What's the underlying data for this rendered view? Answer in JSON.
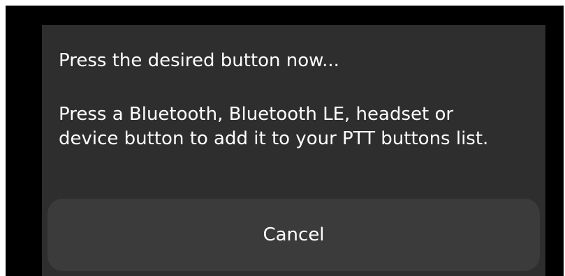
{
  "dialog": {
    "title": "Press the desired button now...",
    "message": "Press a Bluetooth, Bluetooth LE, headset or device button to add it to your PTT buttons list.",
    "cancel_label": "Cancel"
  },
  "colors": {
    "screen_background": "#000000",
    "dialog_background": "#2e2e2e",
    "button_background": "#3b3b3b",
    "text": "#ffffff"
  }
}
